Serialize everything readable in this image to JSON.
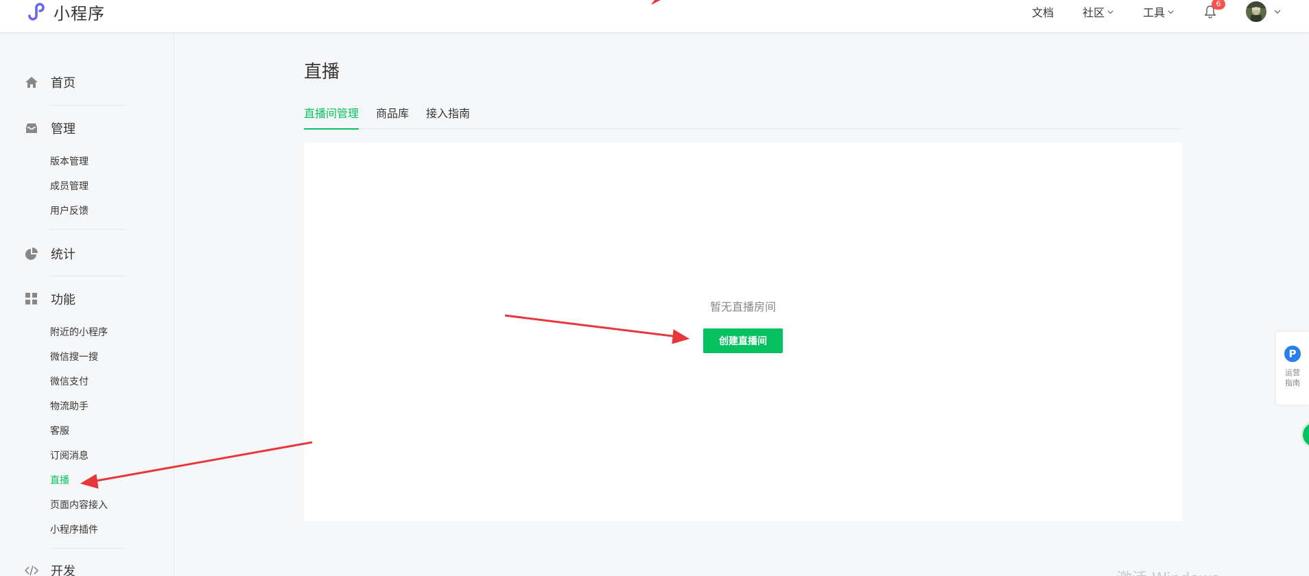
{
  "header": {
    "app_title": "小程序",
    "nav": {
      "docs": "文档",
      "community": "社区",
      "tools": "工具"
    },
    "notification_count": "6"
  },
  "sidebar": {
    "home": "首页",
    "manage": {
      "label": "管理",
      "items": [
        "版本管理",
        "成员管理",
        "用户反馈"
      ]
    },
    "stats": "统计",
    "features": {
      "label": "功能",
      "items": [
        "附近的小程序",
        "微信搜一搜",
        "微信支付",
        "物流助手",
        "客服",
        "订阅消息",
        "直播",
        "页面内容接入",
        "小程序插件"
      ]
    },
    "dev": "开发",
    "active_item": "直播"
  },
  "main": {
    "title": "直播",
    "tabs": [
      "直播间管理",
      "商品库",
      "接入指南"
    ],
    "active_tab": "直播间管理",
    "empty_text": "暂无直播房间",
    "create_button": "创建直播间"
  },
  "float_guide": {
    "badge": "P",
    "label": "运营指南"
  },
  "watermark": "激活 Windows",
  "colors": {
    "accent": "#07c160",
    "badge": "#fa5151",
    "arrow": "#e8373a",
    "guide_blue": "#2b7fec"
  }
}
